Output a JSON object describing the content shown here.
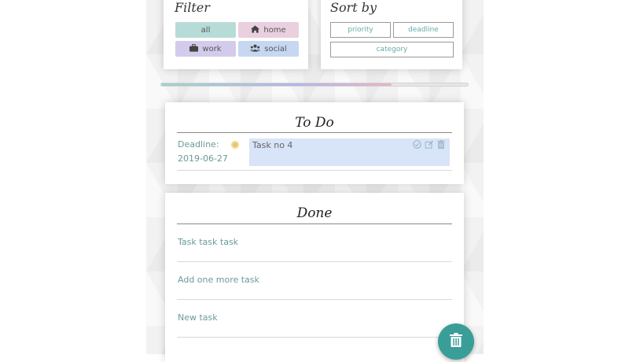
{
  "filter": {
    "title": "Filter",
    "buttons": [
      {
        "label": "all",
        "icon": "",
        "color": "#b7dcd8"
      },
      {
        "label": "home",
        "icon": "home-icon",
        "color": "#ead0de"
      },
      {
        "label": "work",
        "icon": "briefcase-icon",
        "color": "#d3cbeb"
      },
      {
        "label": "social",
        "icon": "users-icon",
        "color": "#c7d7f1"
      }
    ]
  },
  "sort": {
    "title": "Sort by",
    "buttons": [
      "priority",
      "deadline",
      "category"
    ]
  },
  "progress": {
    "fraction": 0.75
  },
  "todo": {
    "title": "To Do",
    "items": [
      {
        "deadline_label": "Deadline:",
        "deadline_date": "2019-06-27",
        "text": "Task no 4",
        "card_color": "#d8e4f7",
        "bullet_color": "#e9c46a"
      }
    ]
  },
  "done": {
    "title": "Done",
    "items": [
      "Task task task",
      "Add one more task",
      "New task"
    ]
  },
  "fab": {
    "icon": "trash-icon",
    "color": "#3a9e98"
  }
}
